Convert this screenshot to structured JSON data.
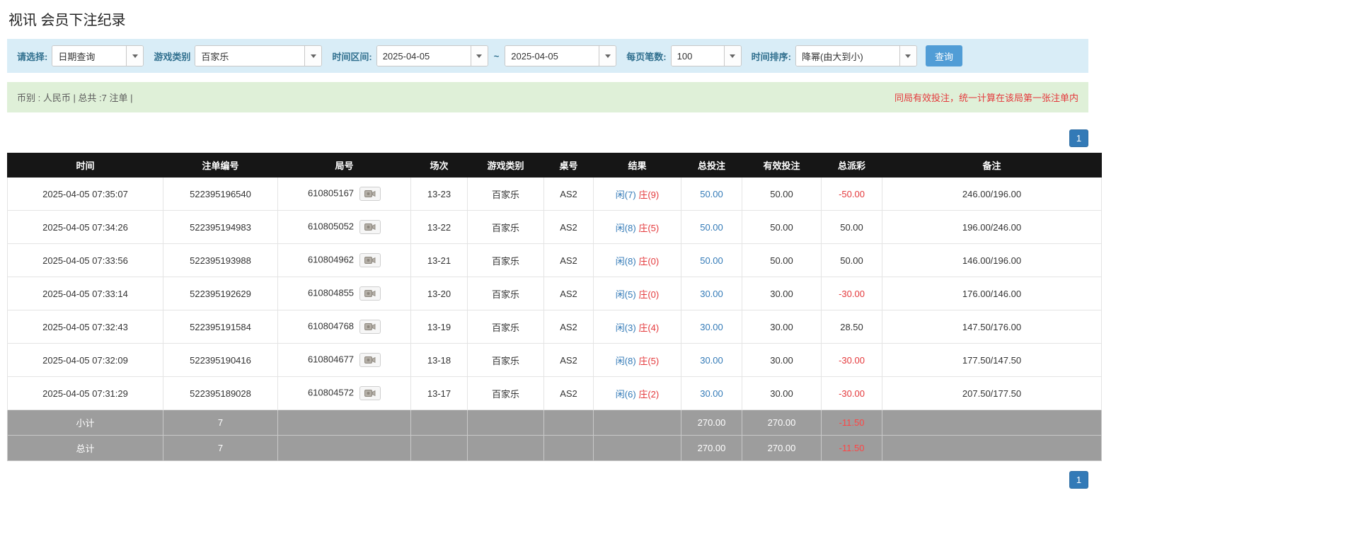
{
  "page": {
    "title": "视讯 会员下注纪录"
  },
  "filters": {
    "select_label": "请选择:",
    "select_value": "日期查询",
    "game_type_label": "游戏类别",
    "game_type_value": "百家乐",
    "time_range_label": "时间区间:",
    "date_from": "2025-04-05",
    "tilde": "~",
    "date_to": "2025-04-05",
    "page_size_label": "每页笔数:",
    "page_size_value": "100",
    "sort_label": "时间排序:",
    "sort_value": "降幂(由大到小)",
    "query_button": "查询"
  },
  "summary": {
    "left": "币别 : 人民币 | 总共 :7 注单 |",
    "right": "同局有效投注，统一计算在该局第一张注单内"
  },
  "pagination": {
    "page": "1"
  },
  "table": {
    "headers": [
      "时间",
      "注单编号",
      "局号",
      "场次",
      "游戏类别",
      "桌号",
      "结果",
      "总投注",
      "有效投注",
      "总派彩",
      "备注"
    ],
    "rows": [
      {
        "time": "2025-04-05 07:35:07",
        "bet_id": "522395196540",
        "round_id": "610805167",
        "session": "13-23",
        "game": "百家乐",
        "table_no": "AS2",
        "result_player": "闲(7)",
        "result_banker": "庄(9)",
        "total_bet": "50.00",
        "valid_bet": "50.00",
        "payout": "-50.00",
        "remark": "246.00/196.00"
      },
      {
        "time": "2025-04-05 07:34:26",
        "bet_id": "522395194983",
        "round_id": "610805052",
        "session": "13-22",
        "game": "百家乐",
        "table_no": "AS2",
        "result_player": "闲(8)",
        "result_banker": "庄(5)",
        "total_bet": "50.00",
        "valid_bet": "50.00",
        "payout": "50.00",
        "remark": "196.00/246.00"
      },
      {
        "time": "2025-04-05 07:33:56",
        "bet_id": "522395193988",
        "round_id": "610804962",
        "session": "13-21",
        "game": "百家乐",
        "table_no": "AS2",
        "result_player": "闲(8)",
        "result_banker": "庄(0)",
        "total_bet": "50.00",
        "valid_bet": "50.00",
        "payout": "50.00",
        "remark": "146.00/196.00"
      },
      {
        "time": "2025-04-05 07:33:14",
        "bet_id": "522395192629",
        "round_id": "610804855",
        "session": "13-20",
        "game": "百家乐",
        "table_no": "AS2",
        "result_player": "闲(5)",
        "result_banker": "庄(0)",
        "total_bet": "30.00",
        "valid_bet": "30.00",
        "payout": "-30.00",
        "remark": "176.00/146.00"
      },
      {
        "time": "2025-04-05 07:32:43",
        "bet_id": "522395191584",
        "round_id": "610804768",
        "session": "13-19",
        "game": "百家乐",
        "table_no": "AS2",
        "result_player": "闲(3)",
        "result_banker": "庄(4)",
        "total_bet": "30.00",
        "valid_bet": "30.00",
        "payout": "28.50",
        "remark": "147.50/176.00"
      },
      {
        "time": "2025-04-05 07:32:09",
        "bet_id": "522395190416",
        "round_id": "610804677",
        "session": "13-18",
        "game": "百家乐",
        "table_no": "AS2",
        "result_player": "闲(8)",
        "result_banker": "庄(5)",
        "total_bet": "30.00",
        "valid_bet": "30.00",
        "payout": "-30.00",
        "remark": "177.50/147.50"
      },
      {
        "time": "2025-04-05 07:31:29",
        "bet_id": "522395189028",
        "round_id": "610804572",
        "session": "13-17",
        "game": "百家乐",
        "table_no": "AS2",
        "result_player": "闲(6)",
        "result_banker": "庄(2)",
        "total_bet": "30.00",
        "valid_bet": "30.00",
        "payout": "-30.00",
        "remark": "207.50/177.50"
      }
    ],
    "subtotal": {
      "label": "小计",
      "count": "7",
      "total_bet": "270.00",
      "valid_bet": "270.00",
      "payout": "-11.50"
    },
    "total": {
      "label": "总计",
      "count": "7",
      "total_bet": "270.00",
      "valid_bet": "270.00",
      "payout": "-11.50"
    }
  }
}
